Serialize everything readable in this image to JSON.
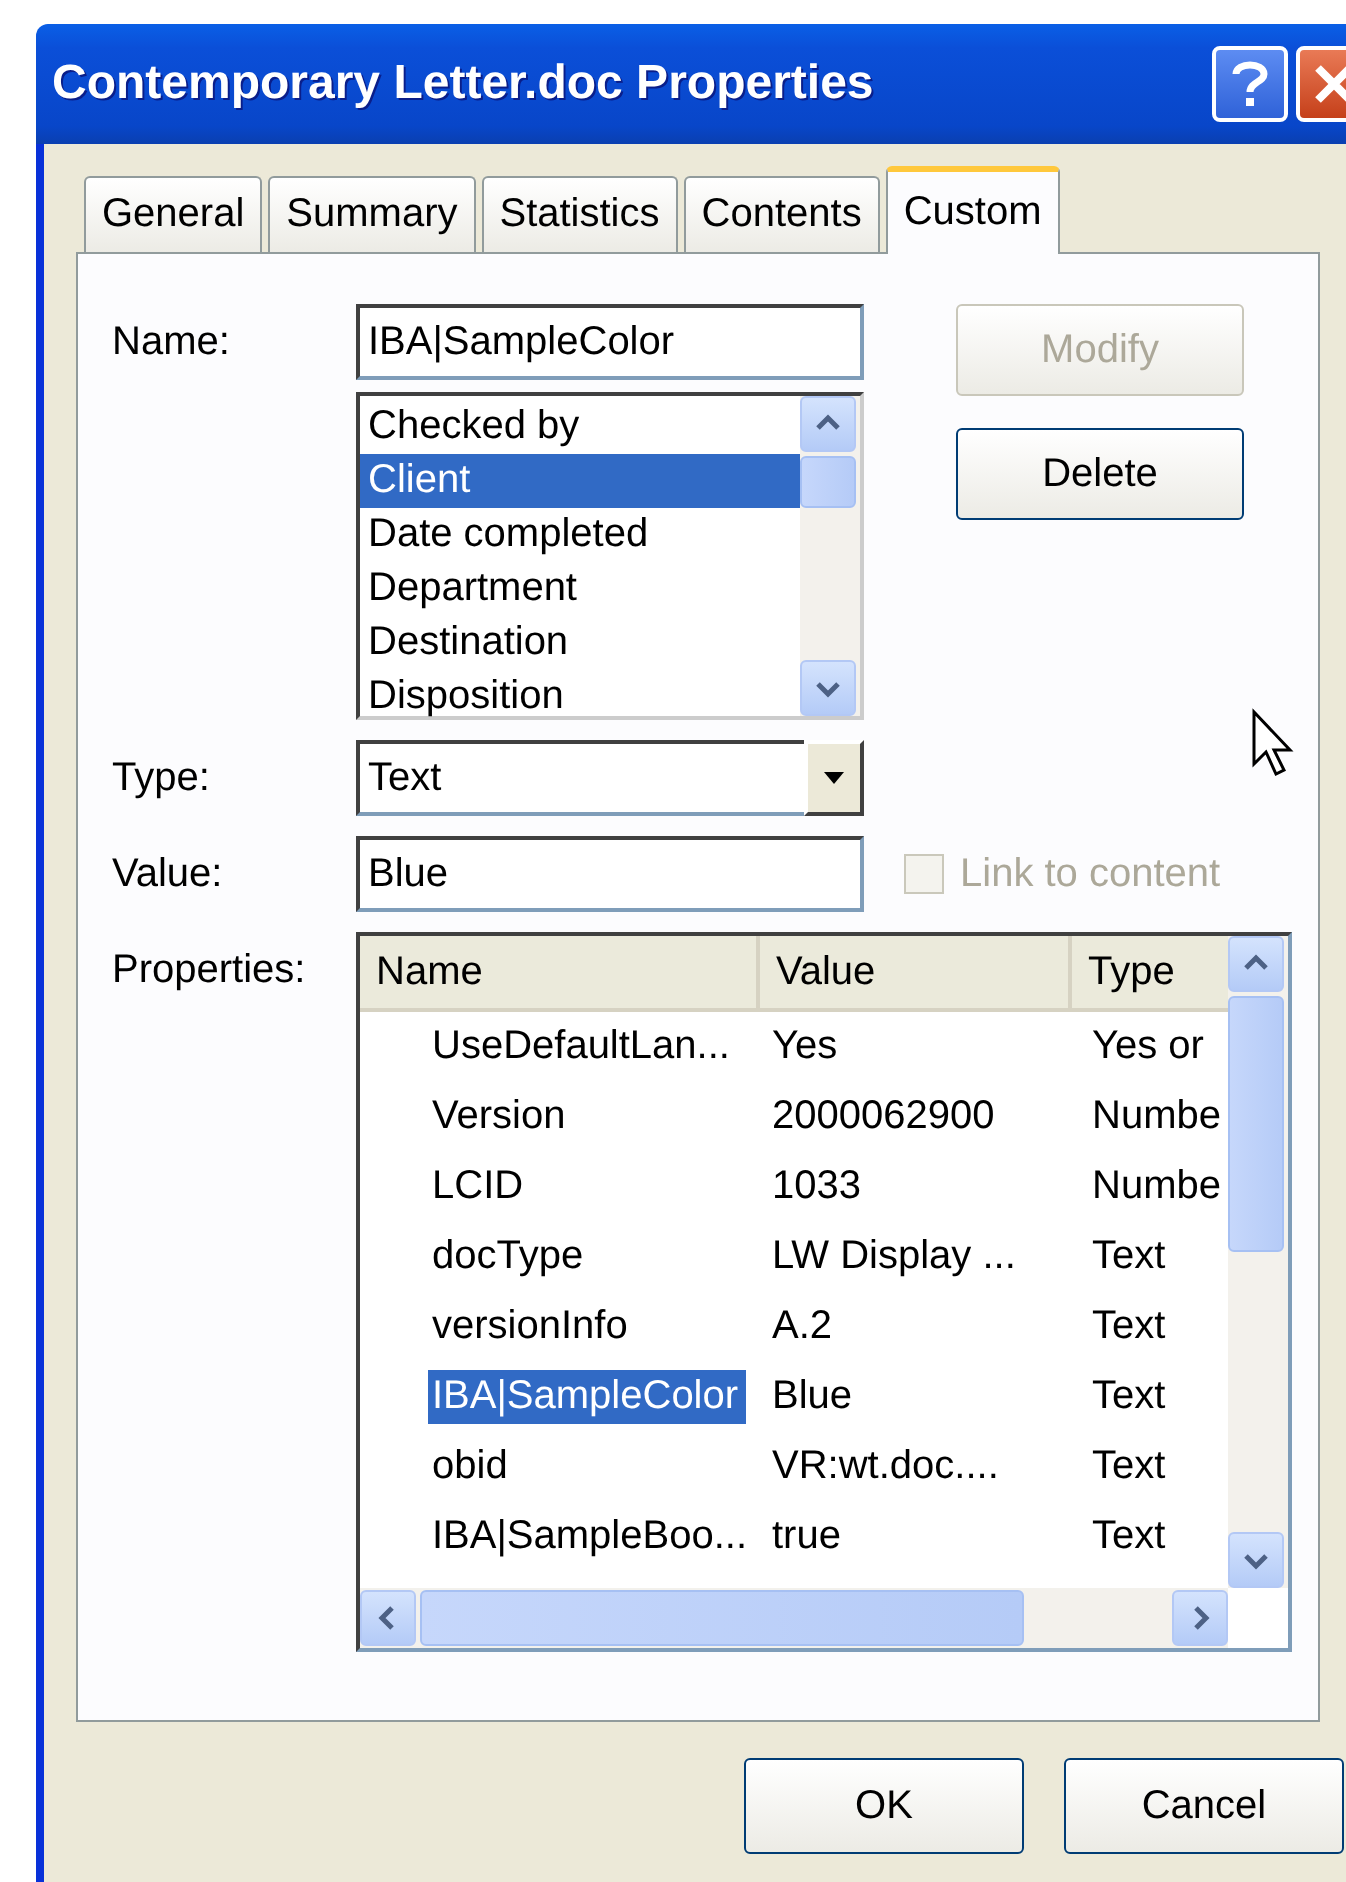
{
  "window": {
    "title": "Contemporary Letter.doc Properties"
  },
  "tabs": [
    {
      "label": "General",
      "selected": false
    },
    {
      "label": "Summary",
      "selected": false
    },
    {
      "label": "Statistics",
      "selected": false
    },
    {
      "label": "Contents",
      "selected": false
    },
    {
      "label": "Custom",
      "selected": true
    }
  ],
  "name_field": {
    "label": "Name:",
    "value": "IBA|SampleColor"
  },
  "side_buttons": [
    {
      "label": "Modify",
      "disabled": true
    },
    {
      "label": "Delete",
      "disabled": false
    }
  ],
  "name_list": [
    {
      "label": "Checked by",
      "selected": false
    },
    {
      "label": "Client",
      "selected": true
    },
    {
      "label": "Date completed",
      "selected": false
    },
    {
      "label": "Department",
      "selected": false
    },
    {
      "label": "Destination",
      "selected": false
    },
    {
      "label": "Disposition",
      "selected": false
    }
  ],
  "type_field": {
    "label": "Type:",
    "value": "Text"
  },
  "value_field": {
    "label": "Value:",
    "value": "Blue"
  },
  "link_to_content": {
    "label": "Link to content",
    "checked": false,
    "disabled": true
  },
  "properties": {
    "label": "Properties:",
    "columns": [
      "Name",
      "Value",
      "Type"
    ],
    "rows": [
      {
        "name": "UseDefaultLan...",
        "value": "Yes",
        "type": "Yes or",
        "selected": false
      },
      {
        "name": "Version",
        "value": "2000062900",
        "type": "Numbe",
        "selected": false
      },
      {
        "name": "LCID",
        "value": "1033",
        "type": "Numbe",
        "selected": false
      },
      {
        "name": "docType",
        "value": "LW Display ...",
        "type": "Text",
        "selected": false
      },
      {
        "name": "versionInfo",
        "value": "A.2",
        "type": "Text",
        "selected": false
      },
      {
        "name": "IBA|SampleColor",
        "value": "Blue",
        "type": "Text",
        "selected": true
      },
      {
        "name": "obid",
        "value": "VR:wt.doc....",
        "type": "Text",
        "selected": false
      },
      {
        "name": "IBA|SampleBoo...",
        "value": "true",
        "type": "Text",
        "selected": false
      }
    ]
  },
  "buttons": [
    "OK",
    "Cancel"
  ]
}
